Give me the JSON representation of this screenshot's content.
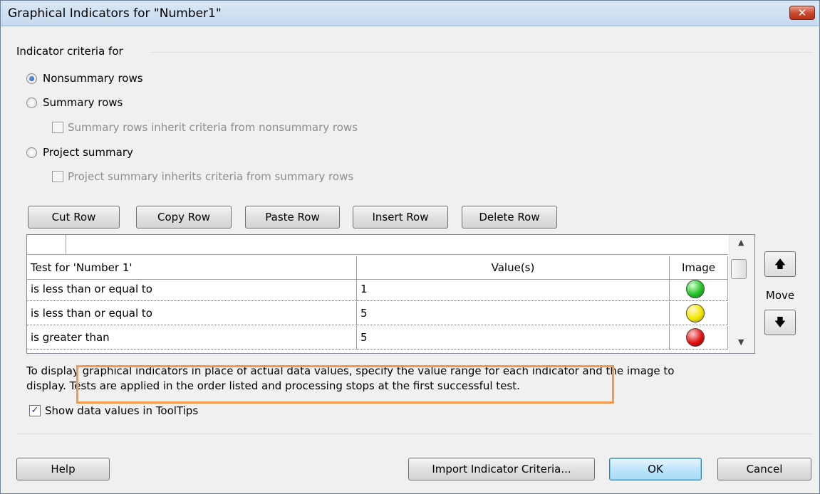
{
  "window": {
    "title": "Graphical Indicators for \"Number1\"",
    "close_label": "✕"
  },
  "criteria": {
    "group_label": "Indicator criteria for",
    "nonsummary": {
      "label": "Nonsummary rows",
      "checked": true
    },
    "summary": {
      "label": "Summary rows",
      "checked": false
    },
    "summary_inherit": {
      "label": "Summary rows inherit criteria from nonsummary rows",
      "checked": false,
      "enabled": false
    },
    "project_summary": {
      "label": "Project summary",
      "checked": false
    },
    "project_inherit": {
      "label": "Project summary inherits criteria from summary rows",
      "checked": false,
      "enabled": false
    }
  },
  "toolbar": {
    "cut_row": "Cut Row",
    "copy_row": "Copy Row",
    "paste_row": "Paste Row",
    "insert_row": "Insert Row",
    "delete_row": "Delete Row"
  },
  "grid": {
    "headers": {
      "test": "Test for 'Number 1'",
      "values": "Value(s)",
      "image": "Image"
    },
    "rows": [
      {
        "test": "is less than or equal to",
        "value": "1",
        "image": "green-circle-icon",
        "color": "#22c322"
      },
      {
        "test": "is less than or equal to",
        "value": "5",
        "image": "yellow-circle-icon",
        "color": "#f2e600"
      },
      {
        "test": "is greater than",
        "value": "5",
        "image": "red-circle-icon",
        "color": "#e01010"
      }
    ]
  },
  "move": {
    "label": "Move",
    "up_icon": "arrow-up-icon",
    "down_icon": "arrow-down-icon"
  },
  "description": {
    "line1": "To display graphical indicators in place of actual data values, specify the value range for each indicator and the image to",
    "line2": "display. Tests are applied in the order listed and processing stops at the first successful test.",
    "highlight_color": "#f2994a"
  },
  "tooltips": {
    "label": "Show data values in ToolTips",
    "checked": true
  },
  "footer": {
    "help": "Help",
    "import": "Import Indicator Criteria...",
    "ok": "OK",
    "cancel": "Cancel"
  }
}
